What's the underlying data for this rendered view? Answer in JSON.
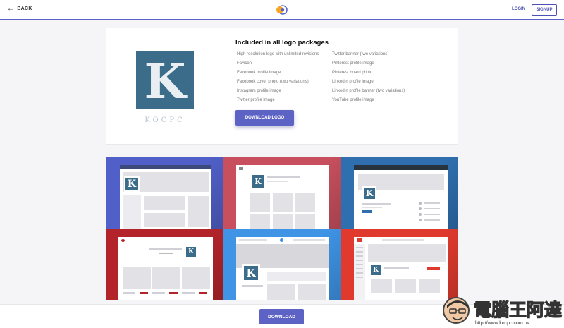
{
  "header": {
    "back_label": "BACK",
    "login_label": "LOGIN",
    "signup_label": "SIGNUP",
    "accent_color": "#5b63c4"
  },
  "package": {
    "logo_letter": "K",
    "logo_caption": "KOCPC",
    "logo_color": "#3b6d8b",
    "title": "Included in all logo packages",
    "items_left": [
      "High resolution logo with unlimited revisions",
      "Favicon",
      "Facebook profile image",
      "Facebook cover photo (two variations)",
      "Instagram profile image",
      "Twitter profile image"
    ],
    "items_right": [
      "Twitter banner (two variations)",
      "Pinterest profile image",
      "Pinterest board photo",
      "LinkedIn profile image",
      "LinkedIn profile banner (two variations)",
      "YouTube profile image"
    ],
    "download_logo_label": "DOWNLOAD LOGO"
  },
  "previews": {
    "mock_letter": "K",
    "mock_caption": "Some Text",
    "tile_colors": [
      "#5060c8",
      "#c8505e",
      "#2f6fb0",
      "#b3242a",
      "#3f94e6",
      "#e03a2e"
    ]
  },
  "footer": {
    "download_label": "DOWNLOAD"
  },
  "watermark": {
    "text": "電腦王阿達",
    "url": "http://www.kocpc.com.tw"
  }
}
